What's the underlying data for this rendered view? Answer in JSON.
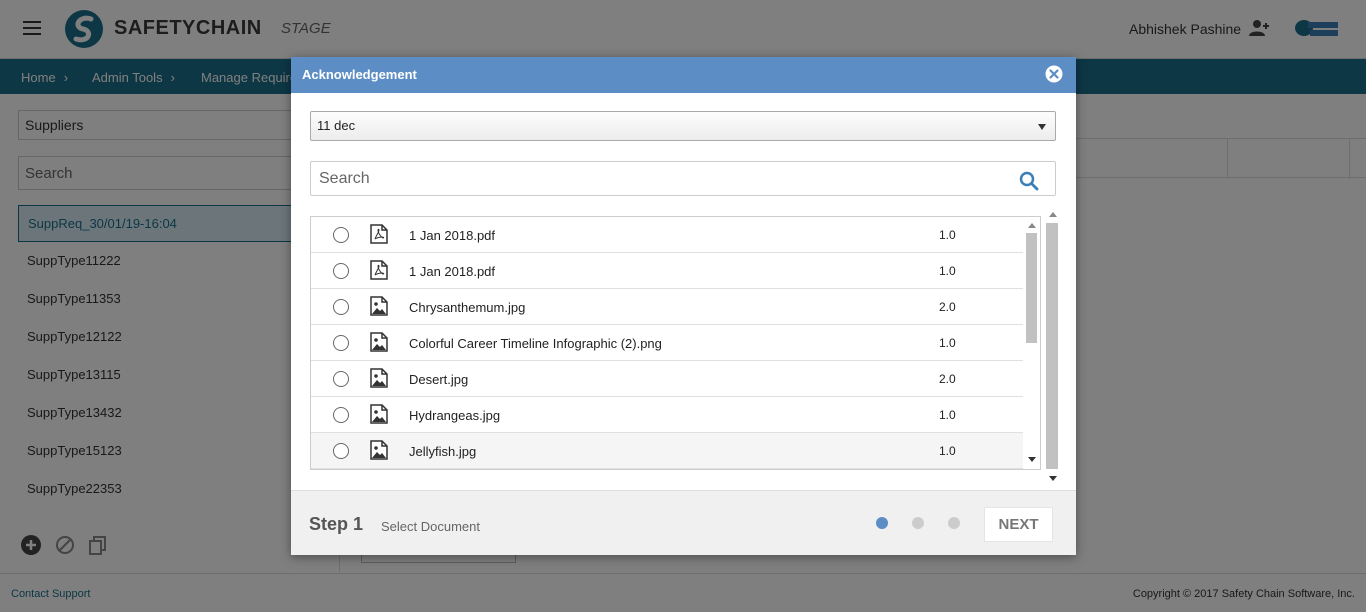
{
  "app": {
    "brand": "SAFETYCHAIN",
    "environment": "STAGE",
    "user_name": "Abhishek Pashine"
  },
  "breadcrumb": [
    {
      "label": "Home"
    },
    {
      "label": "Admin Tools"
    },
    {
      "label": "Manage Require"
    }
  ],
  "left_panel": {
    "select_value": "Suppliers",
    "search_placeholder": "Search",
    "items": [
      {
        "label": "SuppReq_30/01/19-16:04",
        "active": true
      },
      {
        "label": "SuppType11222"
      },
      {
        "label": "SuppType11353"
      },
      {
        "label": "SuppType12122"
      },
      {
        "label": "SuppType13115"
      },
      {
        "label": "SuppType13432"
      },
      {
        "label": "SuppType15123"
      },
      {
        "label": "SuppType22353"
      }
    ]
  },
  "footer": {
    "contact_label": "Contact Support",
    "copyright": "Copyright © 2017 Safety Chain Software, Inc."
  },
  "modal": {
    "title": "Acknowledgement",
    "select_value": "11 dec",
    "search_placeholder": "Search",
    "files": [
      {
        "name": "1 Jan 2018.pdf",
        "version": "1.0",
        "icon": "pdf-icon"
      },
      {
        "name": "1 Jan 2018.pdf",
        "version": "1.0",
        "icon": "pdf-icon"
      },
      {
        "name": "Chrysanthemum.jpg",
        "version": "2.0",
        "icon": "image-icon"
      },
      {
        "name": "Colorful Career Timeline Infographic (2).png",
        "version": "1.0",
        "icon": "image-icon"
      },
      {
        "name": "Desert.jpg",
        "version": "2.0",
        "icon": "image-icon"
      },
      {
        "name": "Hydrangeas.jpg",
        "version": "1.0",
        "icon": "image-icon"
      },
      {
        "name": "Jellyfish.jpg",
        "version": "1.0",
        "icon": "image-icon"
      }
    ],
    "step": {
      "label": "Step 1",
      "description": "Select Document",
      "current": 1,
      "total": 3
    },
    "next_label": "NEXT"
  },
  "colors": {
    "header_blue": "#5c8ec5",
    "breadcrumb_teal": "#1b6e8a",
    "active_dot": "#5c8ec5"
  }
}
